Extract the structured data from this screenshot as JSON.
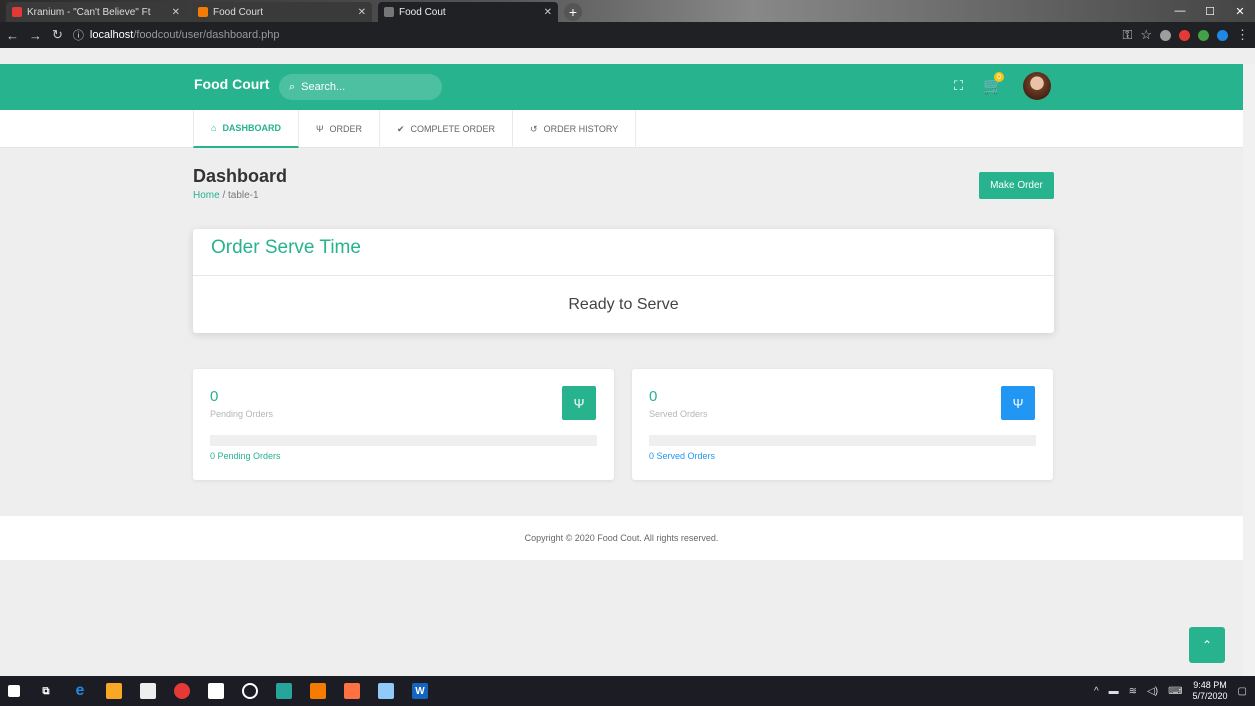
{
  "browser": {
    "tabs": [
      {
        "title": "Kranium - \"Can't Believe\" Ft",
        "color": "#e53935",
        "active": false
      },
      {
        "title": "Food Court",
        "color": "#f57c00",
        "active": false
      },
      {
        "title": "Food Cout",
        "color": "#777777",
        "active": true
      }
    ],
    "url_host": "localhost",
    "url_path": "/foodcout/user/dashboard.php"
  },
  "header": {
    "brand": "Food Court",
    "search_placeholder": "Search...",
    "cart_count": "0"
  },
  "nav": {
    "tabs": [
      {
        "label": "DASHBOARD",
        "icon": "home-icon",
        "glyph": "⌂",
        "active": true
      },
      {
        "label": "ORDER",
        "icon": "utensils-icon",
        "glyph": "🍴",
        "active": false
      },
      {
        "label": "COMPLETE ORDER",
        "icon": "check-icon",
        "glyph": "✔",
        "active": false
      },
      {
        "label": "ORDER HISTORY",
        "icon": "history-icon",
        "glyph": "↺",
        "active": false
      }
    ]
  },
  "page": {
    "title": "Dashboard",
    "breadcrumb_home": "Home",
    "breadcrumb_sep": "/",
    "breadcrumb_current": "table-1",
    "make_order": "Make Order"
  },
  "serve": {
    "title": "Order Serve Time",
    "status": "Ready to Serve"
  },
  "stats": {
    "pending": {
      "count": "0",
      "label": "Pending Orders",
      "link": "0 Pending Orders",
      "progress": 0,
      "color": "#26b38e"
    },
    "served": {
      "count": "0",
      "label": "Served Orders",
      "link": "0 Served Orders",
      "progress": 0,
      "color": "#2196f3"
    }
  },
  "footer": {
    "copyright": "Copyright © 2020 Food Cout. All rights reserved."
  },
  "taskbar": {
    "time": "9:48 PM",
    "date": "5/7/2020"
  },
  "colors": {
    "primary": "#26b38e",
    "info": "#2196f3"
  }
}
